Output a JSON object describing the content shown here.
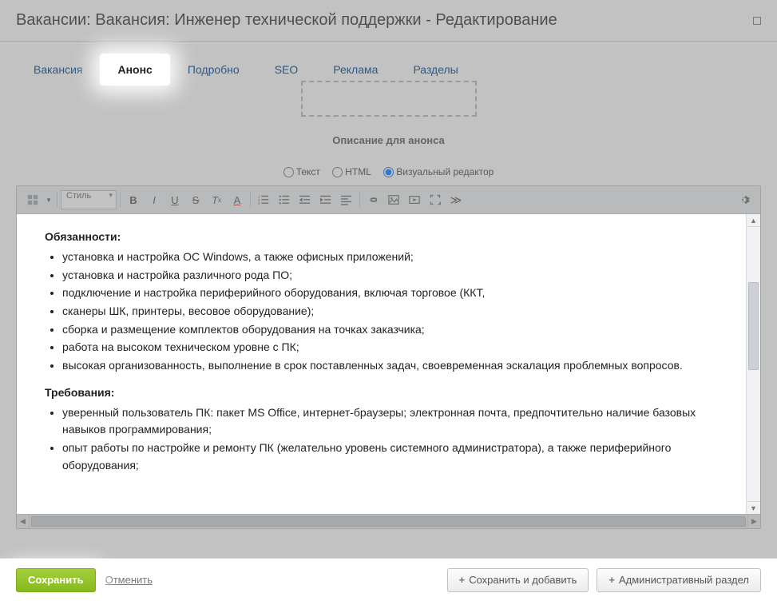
{
  "title": "Вакансии: Вакансия: Инженер технической поддержки - Редактирование",
  "tabs": [
    {
      "label": "Вакансия",
      "active": false
    },
    {
      "label": "Анонс",
      "active": true
    },
    {
      "label": "Подробно",
      "active": false
    },
    {
      "label": "SEO",
      "active": false
    },
    {
      "label": "Реклама",
      "active": false
    },
    {
      "label": "Разделы",
      "active": false
    }
  ],
  "section_header": "Описание для анонса",
  "editor_modes": {
    "text": "Текст",
    "html": "HTML",
    "visual": "Визуальный редактор",
    "selected": "visual"
  },
  "toolbar": {
    "style_label": "Стиль"
  },
  "content": {
    "heading1": "Обязанности:",
    "list1": [
      "установка и настройка ОС Windows, а также офисных приложений;",
      "установка и настройка различного рода ПО;",
      "подключение и настройка периферийного оборудования, включая торговое (ККТ,",
      "сканеры ШК, принтеры, весовое оборудование);",
      "сборка и размещение комплектов оборудования на точках заказчика;",
      "работа на высоком техническом уровне с ПК;",
      "высокая организованность, выполнение в срок поставленных задач, своевременная эскалация проблемных вопросов."
    ],
    "heading2": "Требования:",
    "list2": [
      "уверенный пользователь ПК: пакет MS Office, интернет-браузеры; электронная почта, предпочтительно наличие базовых навыков программирования;",
      "опыт работы по настройке и ремонту ПК (желательно уровень системного администратора), а также периферийного оборудования;"
    ]
  },
  "footer": {
    "save": "Сохранить",
    "cancel": "Отменить",
    "save_add": "Сохранить и добавить",
    "admin": "Административный раздел"
  }
}
